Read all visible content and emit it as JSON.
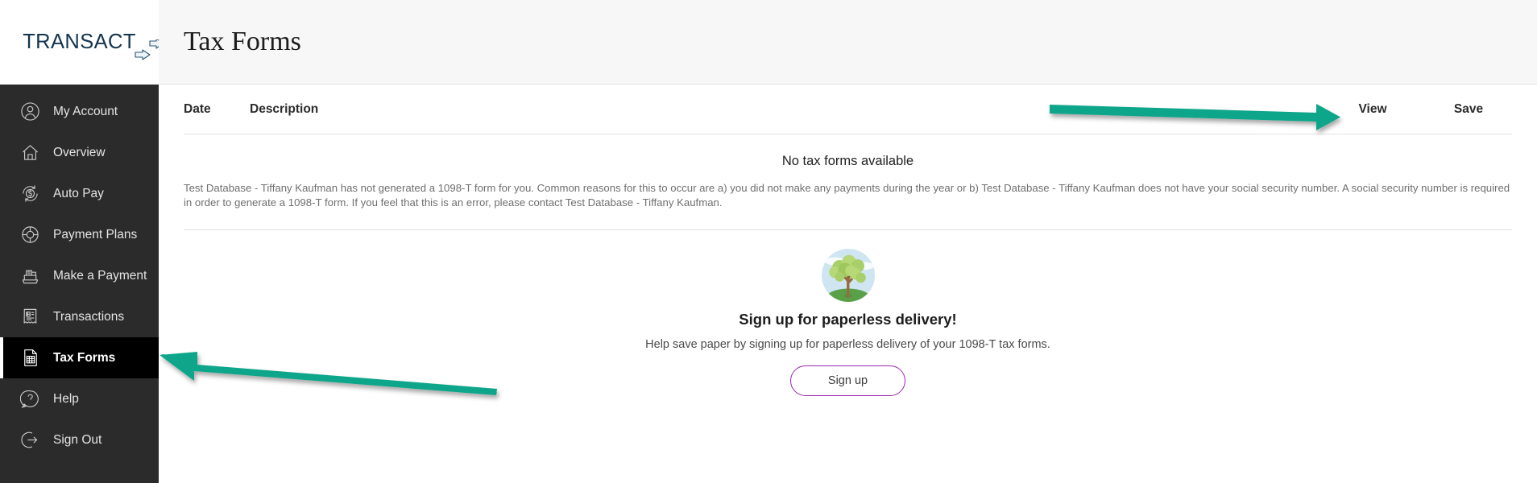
{
  "brand": {
    "name": "TRANSACT",
    "mark_icon": "arrows-mark-icon"
  },
  "sidebar": {
    "items": [
      {
        "label": "My Account",
        "icon": "user-circle-icon",
        "active": false
      },
      {
        "label": "Overview",
        "icon": "home-icon",
        "active": false
      },
      {
        "label": "Auto Pay",
        "icon": "auto-pay-icon",
        "active": false
      },
      {
        "label": "Payment Plans",
        "icon": "payment-plans-icon",
        "active": false
      },
      {
        "label": "Make a Payment",
        "icon": "cash-register-icon",
        "active": false
      },
      {
        "label": "Transactions",
        "icon": "receipt-icon",
        "active": false
      },
      {
        "label": "Tax Forms",
        "icon": "tax-form-icon",
        "active": true
      },
      {
        "label": "Help",
        "icon": "question-icon",
        "active": false
      },
      {
        "label": "Sign Out",
        "icon": "sign-out-icon",
        "active": false
      }
    ]
  },
  "header": {
    "title": "Tax Forms"
  },
  "table": {
    "columns": {
      "date": "Date",
      "description": "Description",
      "view": "View",
      "save": "Save"
    },
    "empty_message": "No tax forms available",
    "explanation": "Test Database - Tiffany Kaufman has not generated a 1098-T form for you. Common reasons for this to occur are a) you did not make any payments during the year or b) Test Database - Tiffany Kaufman does not have your social security number. A social security number is required in order to generate a 1098-T form. If you feel that this is an error, please contact Test Database - Tiffany Kaufman."
  },
  "paperless": {
    "illustration_icon": "tree-illustration-icon",
    "title": "Sign up for paperless delivery!",
    "subtitle": "Help save paper by signing up for paperless delivery of your 1098-T tax forms.",
    "button_label": "Sign up"
  },
  "annotations": {
    "arrow_right": "annotation-arrow-right",
    "arrow_left": "annotation-arrow-left",
    "color": "#0fa68a"
  },
  "colors": {
    "sidebar_bg": "#2b2b2b",
    "sidebar_active_bg": "#000000",
    "brand_navy": "#14344f",
    "header_bg": "#f7f7f7",
    "accent_purple": "#9b27b0",
    "annotation_teal": "#0fa68a"
  }
}
